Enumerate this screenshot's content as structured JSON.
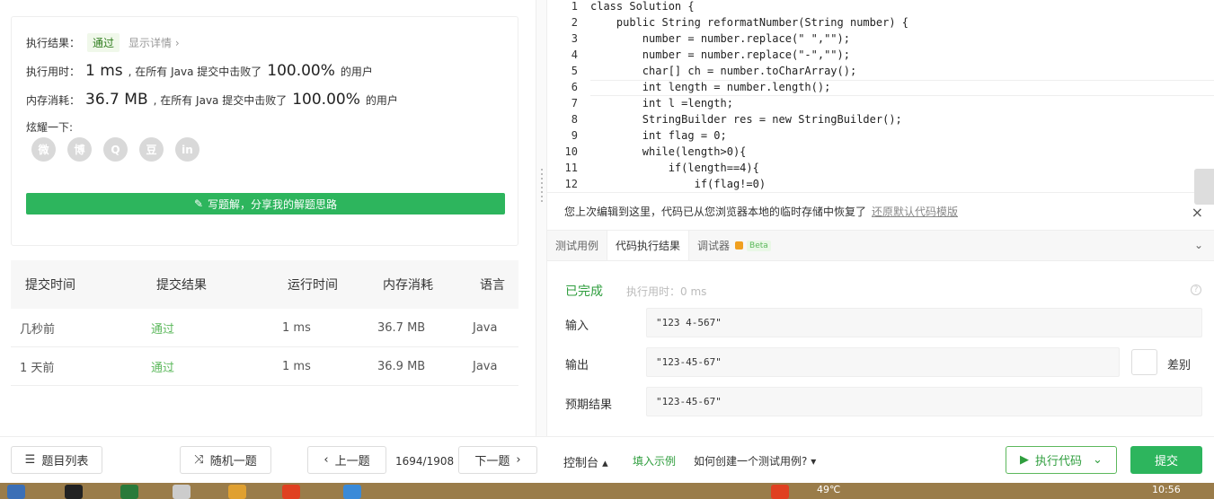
{
  "result": {
    "label": "执行结果：",
    "status": "通过",
    "details_link": "显示详情 ›",
    "time_label": "执行用时：",
    "time_value": "1 ms",
    "time_beat_prefix": ", 在所有 Java 提交中击败了",
    "time_percent": "100.00%",
    "time_beat_suffix": "的用户",
    "mem_label": "内存消耗：",
    "mem_value": "36.7 MB",
    "mem_beat_prefix": ", 在所有 Java 提交中击败了",
    "mem_percent": "100.00%",
    "mem_beat_suffix": "的用户",
    "share_label": "炫耀一下:",
    "share_icons": [
      "wechat-icon",
      "weibo-icon",
      "qq-icon",
      "douban-icon",
      "linkedin-icon"
    ],
    "share_glyphs": [
      "微",
      "博",
      "Q",
      "豆",
      "in"
    ],
    "write_button": "写题解，分享我的解题思路"
  },
  "submissions": {
    "headers": [
      "提交时间",
      "提交结果",
      "运行时间",
      "内存消耗",
      "语言"
    ],
    "rows": [
      {
        "time": "几秒前",
        "result": "通过",
        "runtime": "1 ms",
        "memory": "36.7 MB",
        "lang": "Java"
      },
      {
        "time": "1 天前",
        "result": "通过",
        "runtime": "1 ms",
        "memory": "36.9 MB",
        "lang": "Java"
      }
    ]
  },
  "editor": {
    "line_numbers": [
      "1",
      "2",
      "3",
      "4",
      "5",
      "6",
      "7",
      "8",
      "9",
      "10",
      "11",
      "12"
    ],
    "lines": [
      "class Solution {",
      "    public String reformatNumber(String number) {",
      "        number = number.replace(\" \",\"\");",
      "        number = number.replace(\"-\",\"\");",
      "        char[] ch = number.toCharArray();",
      "        int length = number.length();",
      "        int l =length;",
      "        StringBuilder res = new StringBuilder();",
      "        int flag = 0;",
      "        while(length>0){",
      "            if(length==4){",
      "                if(flag!=0)"
    ]
  },
  "notice": {
    "text": "您上次编辑到这里，代码已从您浏览器本地的临时存储中恢复了",
    "link": "还原默认代码模版",
    "close": "×"
  },
  "tabs": [
    {
      "label": "测试用例"
    },
    {
      "label": "代码执行结果"
    },
    {
      "label": "调试器"
    }
  ],
  "tab_beta": "Beta",
  "run_result": {
    "status": "已完成",
    "runtime": "执行用时：0 ms",
    "input_label": "输入",
    "input_value": "\"123 4-567\"",
    "output_label": "输出",
    "output_value": "\"123-45-67\"",
    "expected_label": "预期结果",
    "expected_value": "\"123-45-67\"",
    "diff_label": "差别"
  },
  "bottom": {
    "problem_list": "题目列表",
    "random": "随机一题",
    "prev": "上一题",
    "counter": "1694/1908",
    "next": "下一题",
    "console": "控制台 ▴",
    "examples": "填入示例",
    "howto": "如何创建一个测试用例?",
    "run": "执行代码",
    "submit": "提交"
  },
  "taskbar": {
    "temperature": "49℃",
    "clock": "10:56"
  }
}
